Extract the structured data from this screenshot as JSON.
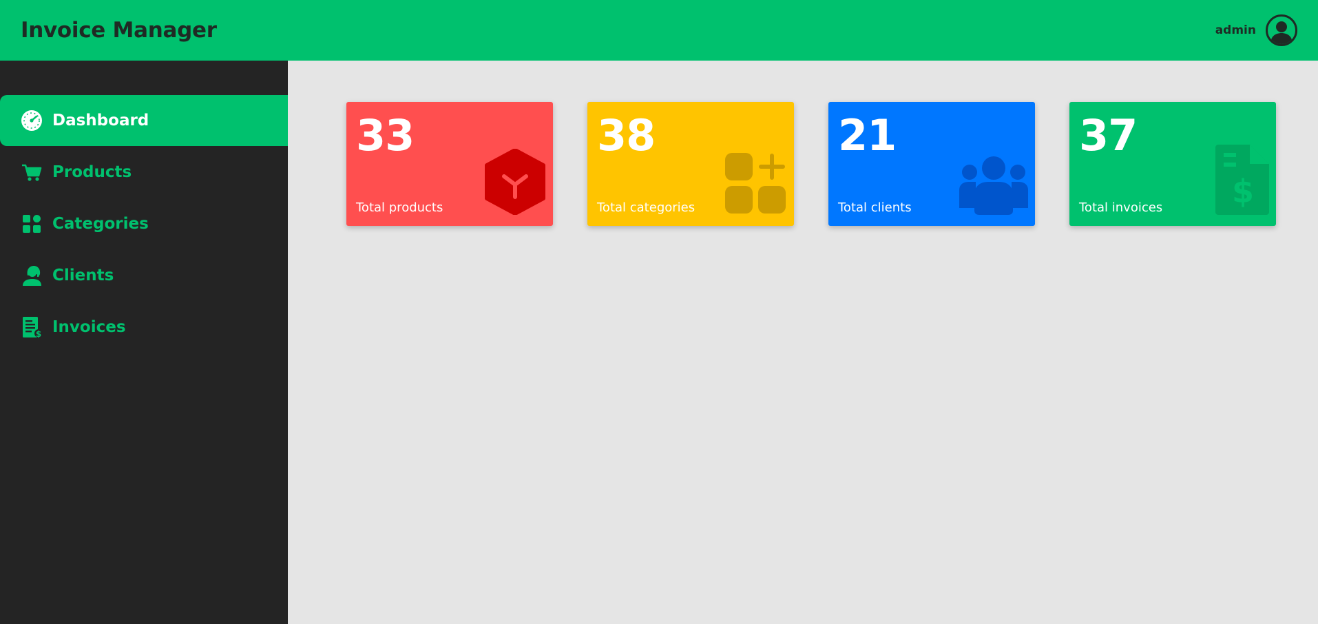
{
  "header": {
    "title": "Invoice Manager",
    "username": "admin",
    "avatar_icon": "user-avatar-icon"
  },
  "sidebar": {
    "items": [
      {
        "label": "Dashboard",
        "icon": "speedometer-icon",
        "active": true
      },
      {
        "label": "Products",
        "icon": "cart-icon",
        "active": false
      },
      {
        "label": "Categories",
        "icon": "grid-icon",
        "active": false
      },
      {
        "label": "Clients",
        "icon": "client-icon",
        "active": false
      },
      {
        "label": "Invoices",
        "icon": "invoice-icon",
        "active": false
      }
    ]
  },
  "cards": [
    {
      "value": "33",
      "label": "Total products",
      "color": "#ff4f4f",
      "icon": "box-icon"
    },
    {
      "value": "38",
      "label": "Total categories",
      "color": "#ffc400",
      "icon": "add-grid-icon"
    },
    {
      "value": "21",
      "label": "Total clients",
      "color": "#0077ff",
      "icon": "users-icon"
    },
    {
      "value": "37",
      "label": "Total invoices",
      "color": "#00c16e",
      "icon": "invoice-dollar-icon"
    }
  ],
  "colors": {
    "brand": "#00c16e",
    "sidebar_bg": "#242424",
    "main_bg": "#e5e5e5"
  }
}
